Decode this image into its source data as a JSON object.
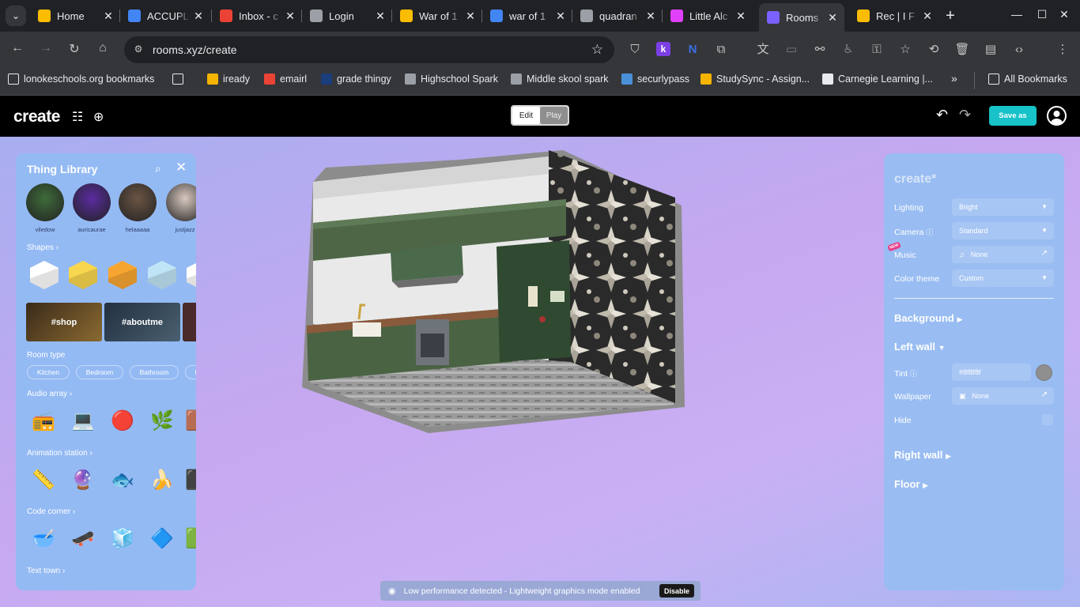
{
  "browser": {
    "tabs": [
      {
        "title": "Home",
        "favicon": "slides-icon",
        "color": "#fbbc04"
      },
      {
        "title": "ACCUPL",
        "favicon": "book-icon",
        "color": "#4285f4"
      },
      {
        "title": "Inbox - c",
        "favicon": "gmail-icon",
        "color": "#ea4335"
      },
      {
        "title": "Login",
        "favicon": "hac-icon",
        "color": "#9aa0a6"
      },
      {
        "title": "War of 1",
        "favicon": "slides-icon",
        "color": "#fbbc04"
      },
      {
        "title": "war of 1",
        "favicon": "google-icon",
        "color": "#4285f4"
      },
      {
        "title": "quadran",
        "favicon": "globe-icon",
        "color": "#9aa0a6"
      },
      {
        "title": "Little Alc",
        "favicon": "flask-icon",
        "color": "#e040fb"
      },
      {
        "title": "Rooms",
        "favicon": "rooms-icon",
        "color": "#7b61ff"
      },
      {
        "title": "Rec | I F",
        "favicon": "star-icon",
        "color": "#fbbc04"
      }
    ],
    "url": "rooms.xyz/create",
    "bookmarks": [
      {
        "label": "lonokeschools.org bookmarks",
        "icon": "folder-icon",
        "color": "#e8eaed"
      },
      {
        "label": "",
        "icon": "apps-grid-icon",
        "color": "#e8eaed"
      },
      {
        "label": "iready",
        "icon": "iready-icon",
        "color": "#f4b400"
      },
      {
        "label": "emairl",
        "icon": "gmail-icon",
        "color": "#ea4335"
      },
      {
        "label": "grade thingy",
        "icon": "hac-icon",
        "color": "#1a3d7c"
      },
      {
        "label": "Highschool Spark",
        "icon": "spark-icon",
        "color": "#9aa0a6"
      },
      {
        "label": "Middle skool spark",
        "icon": "spark-icon",
        "color": "#9aa0a6"
      },
      {
        "label": "securlypass",
        "icon": "securly-icon",
        "color": "#4a90d9"
      },
      {
        "label": "StudySync - Assign...",
        "icon": "studysync-icon",
        "color": "#f4b400"
      },
      {
        "label": "Carnegie Learning |...",
        "icon": "carnegie-icon",
        "color": "#e8eaed"
      }
    ],
    "all_bookmarks": "All Bookmarks"
  },
  "app": {
    "logo": "create",
    "mode_edit": "Edit",
    "mode_play": "Play",
    "save_as": "Save as"
  },
  "library": {
    "title": "Thing Library",
    "creators": [
      {
        "name": "viledow",
        "color": "#3e6b3a"
      },
      {
        "name": "auricaurae",
        "color": "#5a2ca0"
      },
      {
        "name": "helaaaaa",
        "color": "#6b5444"
      },
      {
        "name": "justjazz",
        "color": "#d9c9c0"
      }
    ],
    "shapes_label": "Shapes",
    "shape_colors": [
      "#ffffff",
      "#f8d64e",
      "#f7a531",
      "#bfe4f6",
      "#ffffff"
    ],
    "tags": [
      "#shop",
      "#aboutme"
    ],
    "room_type_label": "Room type",
    "room_types": [
      "Kitchen",
      "Bedroom",
      "Bathroom",
      "L"
    ],
    "audio_label": "Audio array",
    "animation_label": "Animation station",
    "code_label": "Code corner",
    "text_label": "Text town"
  },
  "settings": {
    "logo": "create*",
    "lighting_label": "Lighting",
    "lighting_value": "Bright",
    "camera_label": "Camera",
    "camera_value": "Standard",
    "music_label": "Music",
    "music_badge": "NEW",
    "music_value": "None",
    "color_theme_label": "Color theme",
    "color_theme_value": "Custom",
    "background_label": "Background",
    "left_wall_label": "Left wall",
    "tint_label": "Tint",
    "tint_value": "#8f8f8f",
    "wallpaper_label": "Wallpaper",
    "wallpaper_value": "None",
    "hide_label": "Hide",
    "right_wall_label": "Right wall",
    "floor_label": "Floor"
  },
  "toast": {
    "message": "Low performance detected - Lightweight graphics mode enabled",
    "action": "Disable"
  }
}
